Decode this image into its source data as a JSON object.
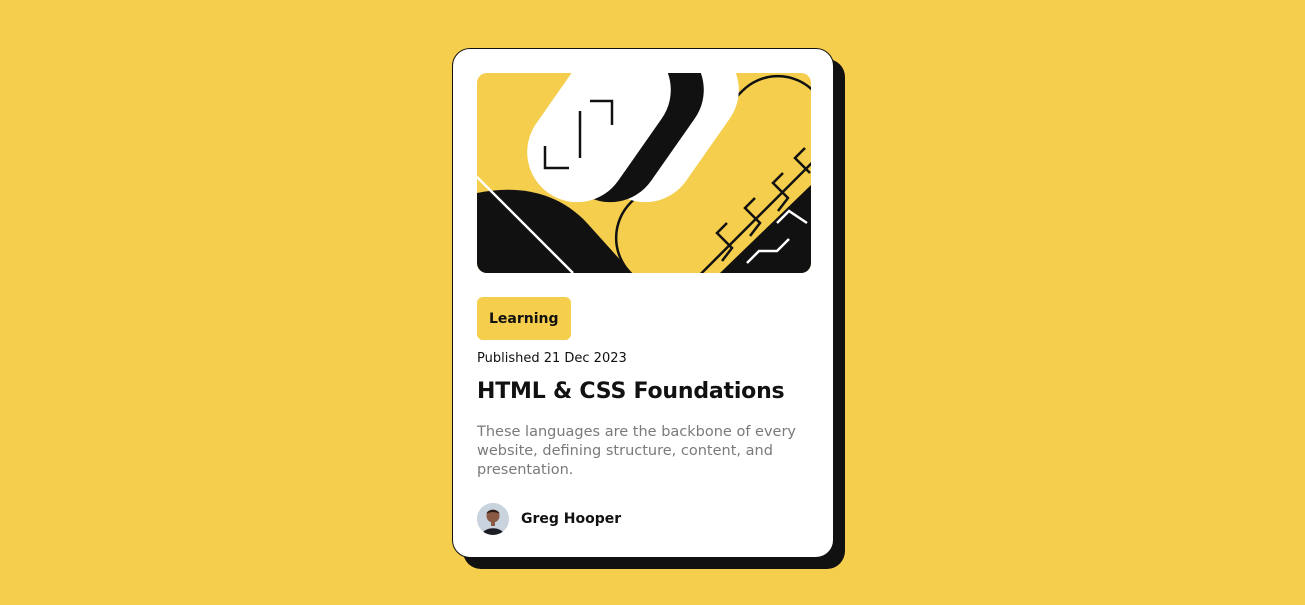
{
  "colors": {
    "background": "#F4CE4C",
    "card": "#FFFFFF",
    "ink": "#111111",
    "muted": "#7A7A7A",
    "tag_background": "#F4CE4C"
  },
  "card": {
    "illustration": "abstract-yellow-black-illustration",
    "tag": "Learning",
    "published": "Published 21 Dec 2023",
    "title": "HTML & CSS Foundations",
    "description": "These languages are the backbone of every website, defining structure, content, and presentation.",
    "author": {
      "avatar": "author-avatar-photo",
      "name": "Greg Hooper"
    }
  }
}
